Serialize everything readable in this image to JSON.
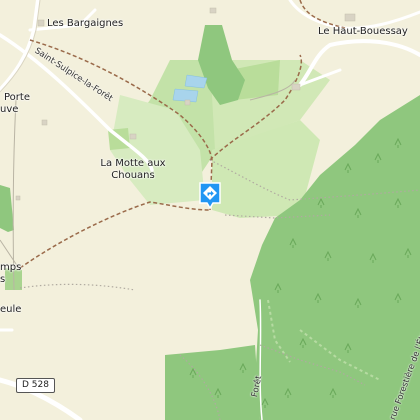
{
  "map": {
    "places": {
      "les_bargaignes": "Les Bargaignes",
      "le_haut_bouessay": "Le Haut-Bouessay",
      "la_motte_1": "La Motte aux",
      "la_motte_2": "Chouans",
      "porte_1": "Porte",
      "porte_2": "uve",
      "champs_1": "mps",
      "champs_2": "s",
      "eule": "eule"
    },
    "road_labels": {
      "saint_sulpice": "Saint-Sulpice-la-Forêt",
      "foret_bottom": "Forêt",
      "foret_right": "rue Forestière de l'Étang du G"
    },
    "road_badge": "D 528",
    "colors": {
      "background": "#f3f0dc",
      "forest": "#8fc77e",
      "meadow": "#b9dd9a",
      "water": "#a8d4ec",
      "trail": "#9a6a4a",
      "marker": "#2196f3"
    },
    "icons": {
      "marker": "direction-sign-icon"
    }
  }
}
